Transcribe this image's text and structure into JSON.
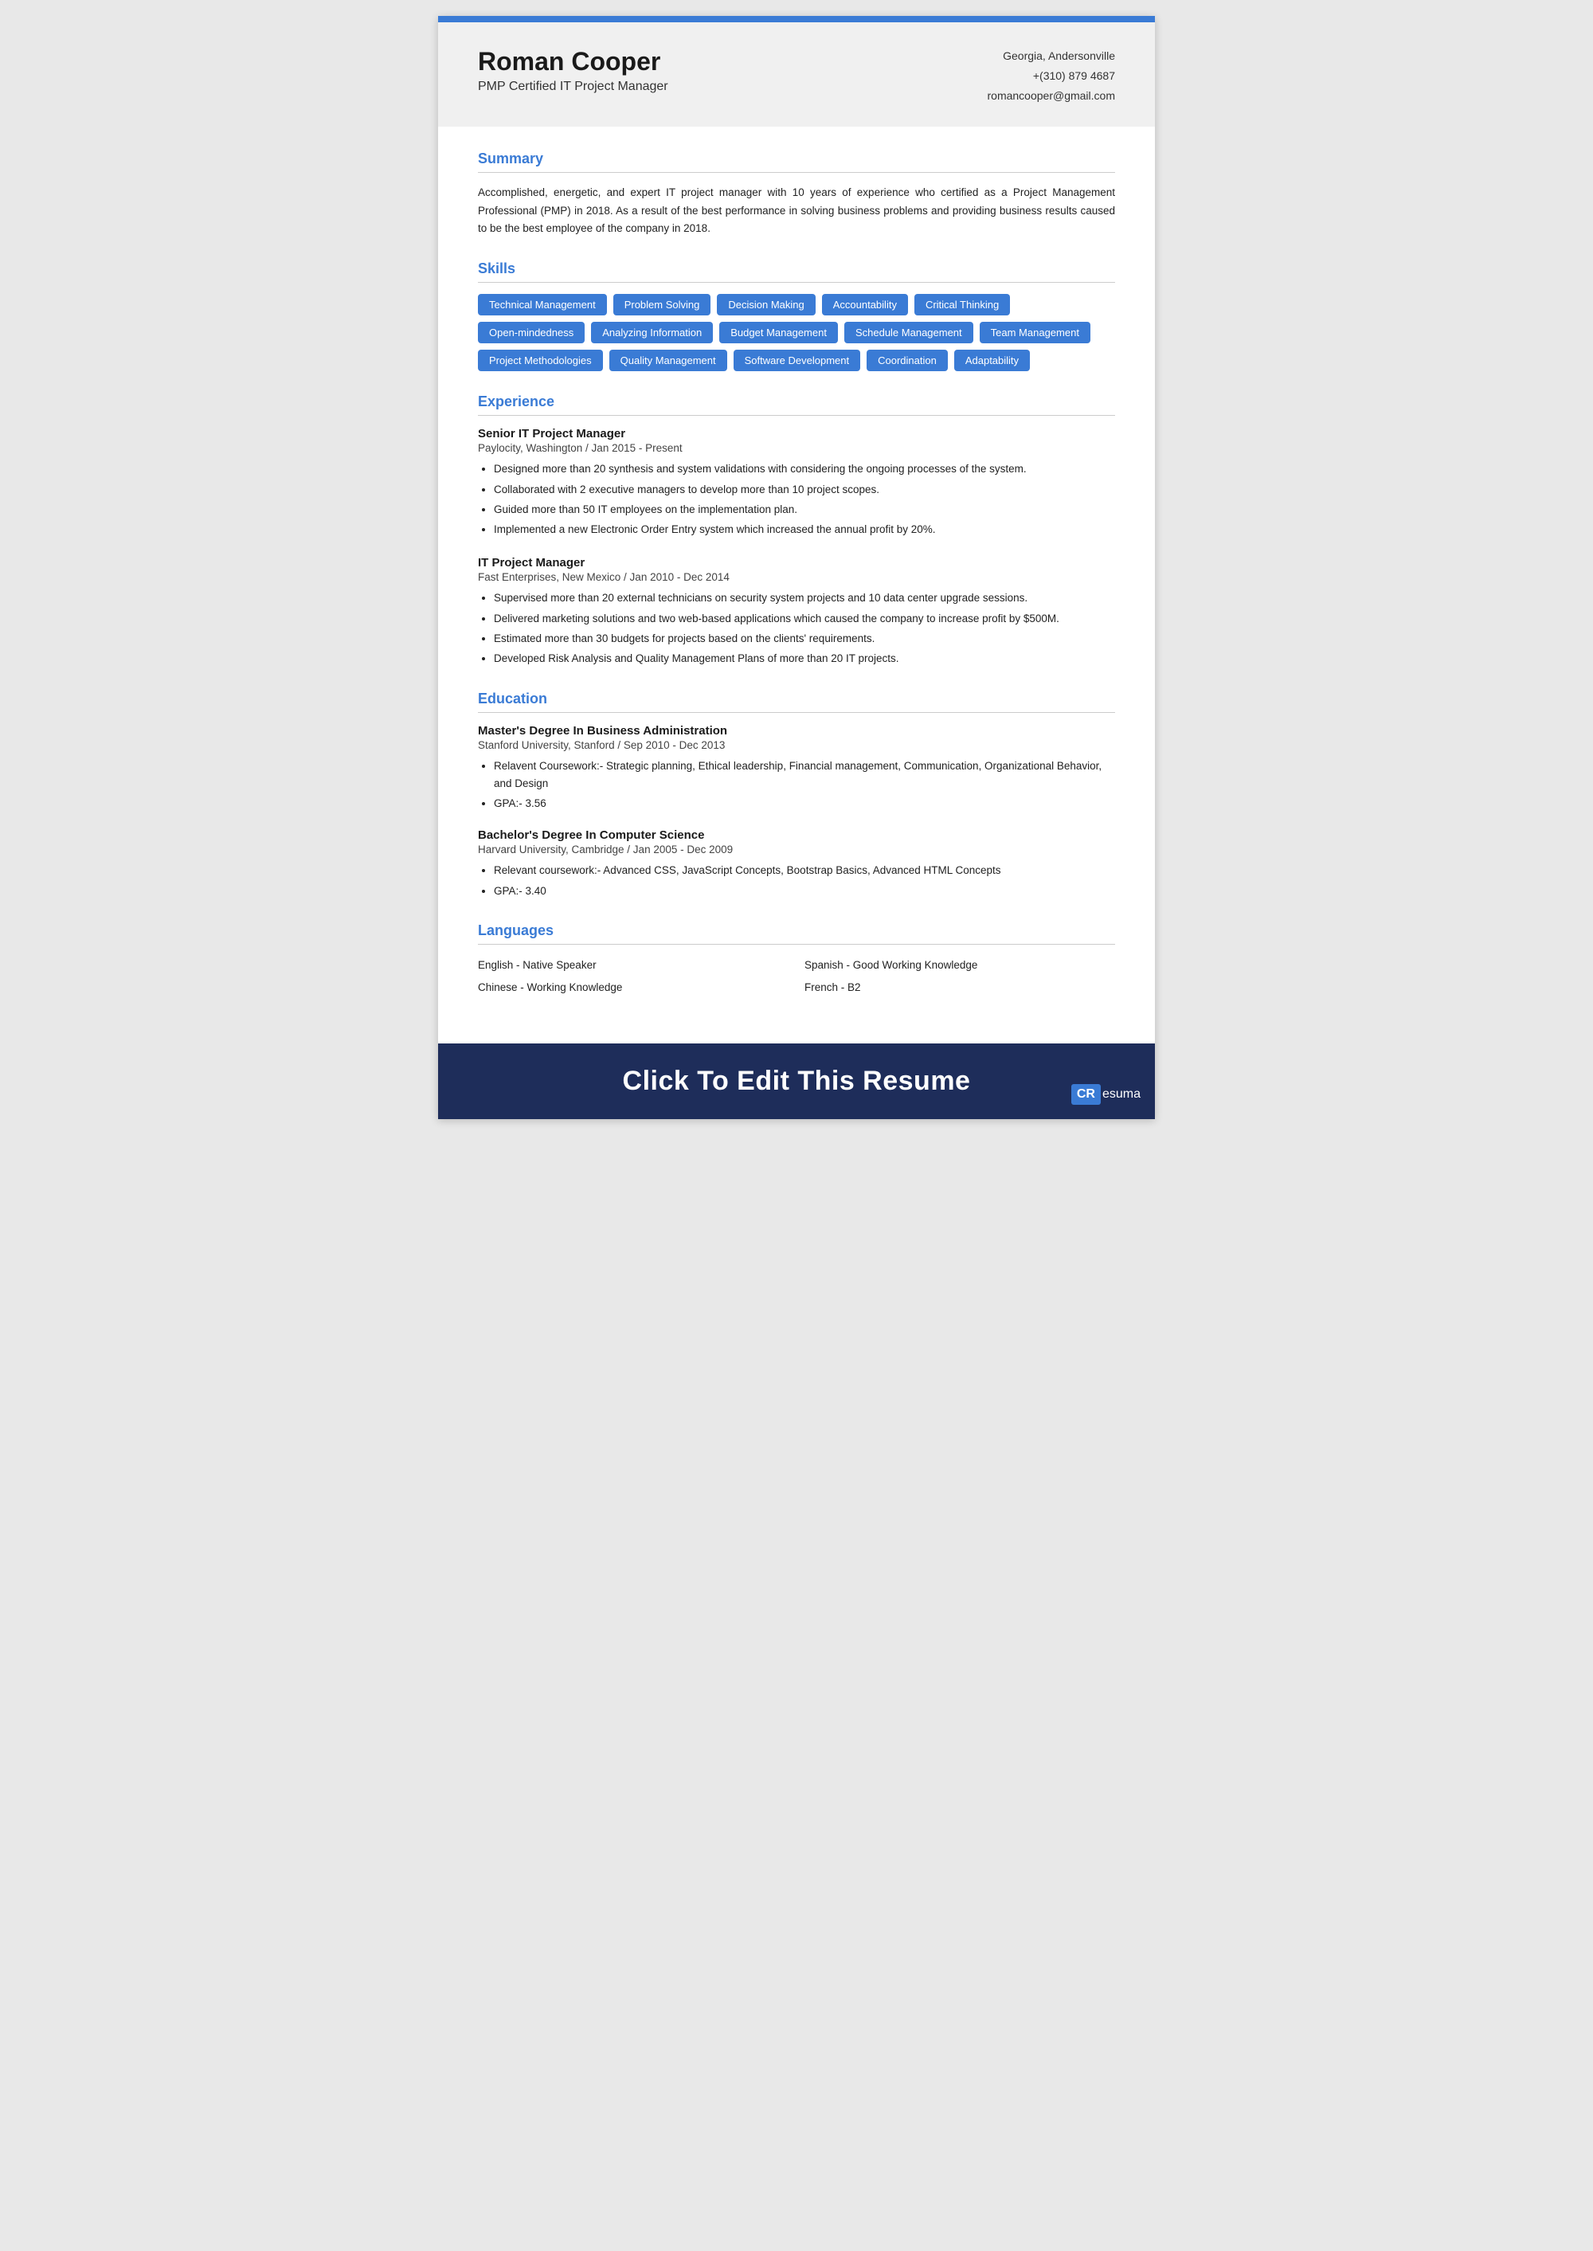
{
  "topBar": {},
  "header": {
    "name": "Roman Cooper",
    "title": "PMP Certified IT Project Manager",
    "location": "Georgia, Andersonville",
    "phone": "+(310) 879 4687",
    "email": "romancooper@gmail.com"
  },
  "sections": {
    "summary": {
      "title": "Summary",
      "text": "Accomplished, energetic, and expert IT project manager with 10 years of experience who certified as a Project Management Professional (PMP) in 2018. As a result of the best performance in solving business problems and providing business results caused to be the best employee of the company in 2018."
    },
    "skills": {
      "title": "Skills",
      "tags": [
        "Technical Management",
        "Problem Solving",
        "Decision Making",
        "Accountability",
        "Critical Thinking",
        "Open-mindedness",
        "Analyzing Information",
        "Budget Management",
        "Schedule Management",
        "Team Management",
        "Project Methodologies",
        "Quality Management",
        "Software Development",
        "Coordination",
        "Adaptability"
      ]
    },
    "experience": {
      "title": "Experience",
      "jobs": [
        {
          "title": "Senior IT Project Manager",
          "company": "Paylocity, Washington / Jan 2015 - Present",
          "bullets": [
            "Designed more than 20 synthesis and system validations with considering the ongoing processes of the system.",
            "Collaborated with 2 executive managers to develop more than 10 project scopes.",
            "Guided more than 50 IT employees on the implementation plan.",
            "Implemented a new Electronic Order Entry system which increased the annual profit by 20%."
          ]
        },
        {
          "title": "IT Project Manager",
          "company": "Fast Enterprises, New Mexico / Jan 2010 - Dec 2014",
          "bullets": [
            "Supervised more than 20 external technicians on security system projects and 10 data center upgrade sessions.",
            "Delivered marketing solutions and two web-based applications which caused the company to increase profit by $500M.",
            "Estimated more than 30 budgets for projects based on the clients' requirements.",
            "Developed Risk Analysis and Quality Management Plans of more than 20 IT projects."
          ]
        }
      ]
    },
    "education": {
      "title": "Education",
      "degrees": [
        {
          "degree": "Master's Degree In Business Administration",
          "school": "Stanford University, Stanford / Sep 2010 - Dec 2013",
          "bullets": [
            "Relavent Coursework:- Strategic planning, Ethical leadership, Financial management, Communication, Organizational Behavior, and Design",
            "GPA:- 3.56"
          ]
        },
        {
          "degree": "Bachelor's Degree In Computer Science",
          "school": "Harvard University, Cambridge / Jan 2005 - Dec 2009",
          "bullets": [
            "Relevant coursework:- Advanced CSS, JavaScript Concepts,  Bootstrap Basics, Advanced HTML Concepts",
            "GPA:- 3.40"
          ]
        }
      ]
    },
    "languages": {
      "title": "Languages",
      "items": [
        {
          "label": "English - Native Speaker",
          "col": 1
        },
        {
          "label": "Spanish - Good Working Knowledge",
          "col": 2
        },
        {
          "label": "Chinese - Working Knowledge",
          "col": 1
        },
        {
          "label": "French - B2",
          "col": 2
        }
      ]
    }
  },
  "footer": {
    "cta": "Click To Edit This Resume",
    "logo_prefix": "CR",
    "logo_suffix": "esuma"
  }
}
